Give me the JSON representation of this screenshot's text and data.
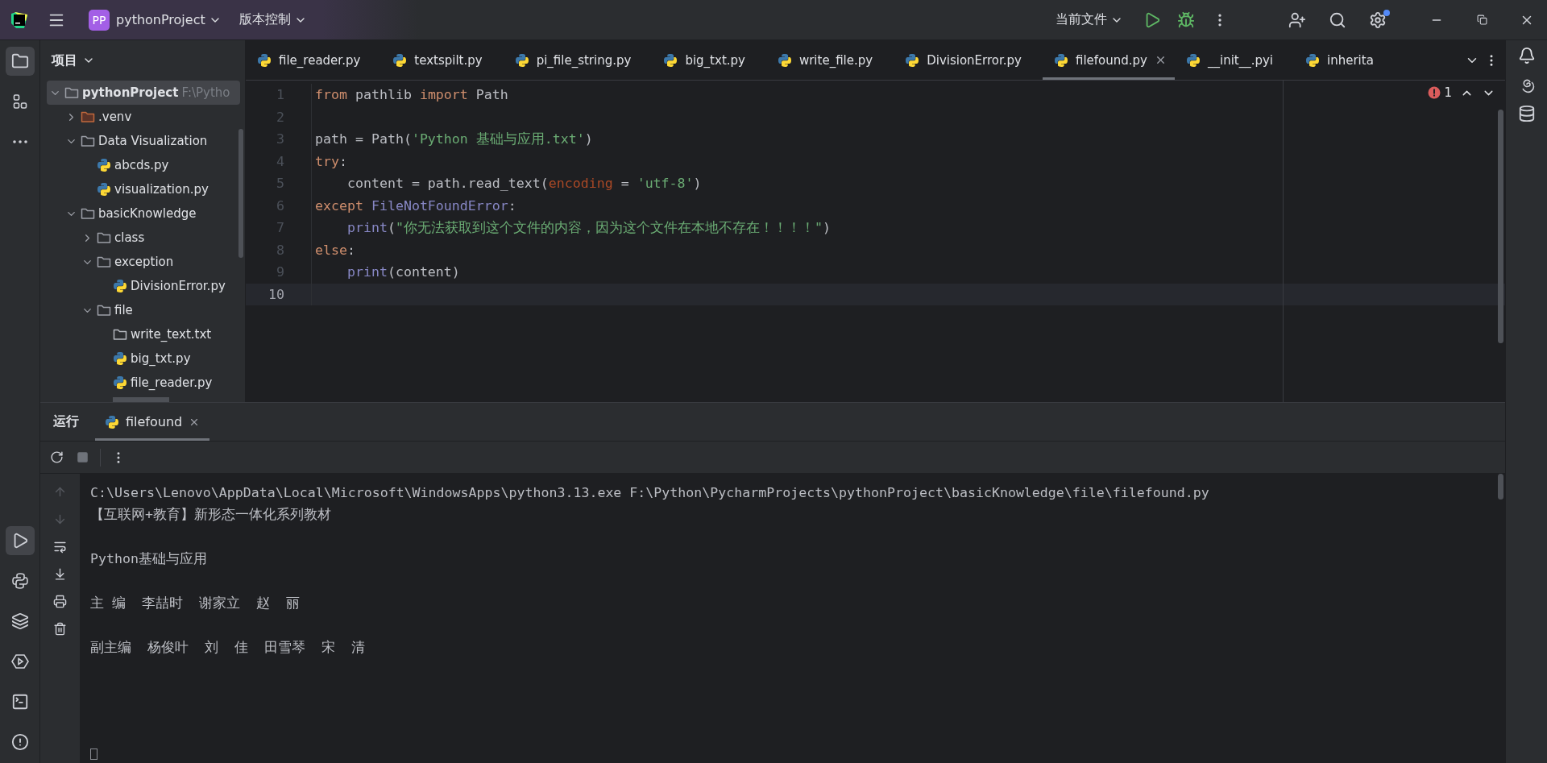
{
  "title_bar": {
    "project_badge": "PP",
    "project": "pythonProject",
    "vcs": "版本控制",
    "run_config": "当前文件"
  },
  "left_toolbar": {
    "top": [
      {
        "kind": "project",
        "selected": true
      },
      {
        "kind": "structure",
        "selected": false
      },
      {
        "kind": "more",
        "selected": false
      }
    ],
    "bottom": [
      {
        "kind": "run",
        "selected": true
      },
      {
        "kind": "python",
        "selected": false
      },
      {
        "kind": "layers",
        "selected": false
      },
      {
        "kind": "services",
        "selected": false
      },
      {
        "kind": "terminal",
        "selected": false
      },
      {
        "kind": "problems",
        "selected": false
      }
    ]
  },
  "project_panel": {
    "title": "项目",
    "tree": [
      {
        "name": "pythonProject",
        "path": "F:\\Pytho",
        "kind": "folder",
        "expanded": true,
        "selected": true,
        "children": [
          {
            "name": ".venv",
            "kind": "venv",
            "expanded": false,
            "selected": false
          },
          {
            "name": "Data Visualization",
            "kind": "folder",
            "expanded": true,
            "selected": false,
            "children": [
              {
                "name": "abcds.py",
                "kind": "python",
                "selected": false
              },
              {
                "name": "visualization.py",
                "kind": "python",
                "selected": false
              }
            ]
          },
          {
            "name": "basicKnowledge",
            "kind": "folder",
            "expanded": true,
            "selected": false,
            "children": [
              {
                "name": "class",
                "kind": "folder",
                "expanded": false,
                "selected": false
              },
              {
                "name": "exception",
                "kind": "folder",
                "expanded": true,
                "selected": false,
                "children": [
                  {
                    "name": "DivisionError.py",
                    "kind": "python",
                    "selected": false
                  }
                ]
              },
              {
                "name": "file",
                "kind": "folder",
                "expanded": true,
                "selected": false,
                "children": [
                  {
                    "name": "write_text.txt",
                    "kind": "plainfolder",
                    "selected": false
                  },
                  {
                    "name": "big_txt.py",
                    "kind": "python",
                    "selected": false
                  },
                  {
                    "name": "file_reader.py",
                    "kind": "python",
                    "selected": false
                  }
                ]
              }
            ]
          }
        ]
      }
    ]
  },
  "editor": {
    "tabs": [
      {
        "label": "file_reader.py",
        "selected": false
      },
      {
        "label": "textspilt.py",
        "selected": false
      },
      {
        "label": "pi_file_string.py",
        "selected": false
      },
      {
        "label": "big_txt.py",
        "selected": false
      },
      {
        "label": "write_file.py",
        "selected": false
      },
      {
        "label": "DivisionError.py",
        "selected": false
      },
      {
        "label": "filefound.py",
        "selected": true
      },
      {
        "label": "__init__.pyi",
        "selected": false
      },
      {
        "label": "inherita",
        "selected": false
      }
    ],
    "error_count": "1",
    "lines": [
      {
        "number": "1",
        "current": false,
        "tokens": [
          {
            "text": "from",
            "kind": "keyword"
          },
          {
            "text": " pathlib ",
            "kind": "plain"
          },
          {
            "text": "import",
            "kind": "keyword"
          },
          {
            "text": " Path",
            "kind": "plain"
          }
        ]
      },
      {
        "number": "2",
        "current": false
      },
      {
        "number": "3",
        "current": false,
        "tokens": [
          {
            "text": "path = Path(",
            "kind": "plain"
          },
          {
            "text": "'Python 基础与应用.txt'",
            "kind": "string"
          },
          {
            "text": ")",
            "kind": "plain"
          }
        ]
      },
      {
        "number": "4",
        "current": false,
        "tokens": [
          {
            "text": "try",
            "kind": "keyword"
          },
          {
            "text": ":",
            "kind": "plain"
          }
        ]
      },
      {
        "number": "5",
        "current": false,
        "tokens": [
          {
            "text": "    content = path.read_text(",
            "kind": "plain"
          },
          {
            "text": "encoding",
            "kind": "param"
          },
          {
            "text": " = ",
            "kind": "plain"
          },
          {
            "text": "'utf-8'",
            "kind": "string"
          },
          {
            "text": ")",
            "kind": "plain"
          }
        ]
      },
      {
        "number": "6",
        "current": false,
        "tokens": [
          {
            "text": "except ",
            "kind": "keyword"
          },
          {
            "text": "FileNotFoundError",
            "kind": "class"
          },
          {
            "text": ":",
            "kind": "plain"
          }
        ]
      },
      {
        "number": "7",
        "current": false,
        "tokens": [
          {
            "text": "    print",
            "kind": "builtin"
          },
          {
            "text": "(",
            "kind": "plain"
          },
          {
            "text": "\"你无法获取到这个文件的内容，因为这个文件在本地不存在！！！！\"",
            "kind": "string"
          },
          {
            "text": ")",
            "kind": "plain"
          }
        ]
      },
      {
        "number": "8",
        "current": false,
        "tokens": [
          {
            "text": "else",
            "kind": "keyword"
          },
          {
            "text": ":",
            "kind": "plain"
          }
        ]
      },
      {
        "number": "9",
        "current": false,
        "tokens": [
          {
            "text": "    print",
            "kind": "builtin"
          },
          {
            "text": "(content)",
            "kind": "plain"
          }
        ]
      },
      {
        "number": "10",
        "current": true
      }
    ]
  },
  "run_panel": {
    "title": "运行",
    "tabs": [
      {
        "label": "filefound",
        "selected": true
      }
    ],
    "console": {
      "command": "C:\\Users\\Lenovo\\AppData\\Local\\Microsoft\\WindowsApps\\python3.13.exe F:\\Python\\PycharmProjects\\pythonProject\\basicKnowledge\\file\\filefound.py",
      "lines": [
        {
          "kind": "text",
          "text": "【互联网+教育】新形态一体化系列教材"
        },
        {
          "kind": "blank"
        },
        {
          "kind": "text",
          "text": "Python基础与应用"
        },
        {
          "kind": "blank"
        },
        {
          "kind": "text",
          "text": "主 编  李喆时  谢家立  赵  丽"
        },
        {
          "kind": "blank"
        },
        {
          "kind": "text",
          "text": "副主编  杨俊叶  刘  佳  田雪琴  宋  清"
        }
      ]
    }
  }
}
